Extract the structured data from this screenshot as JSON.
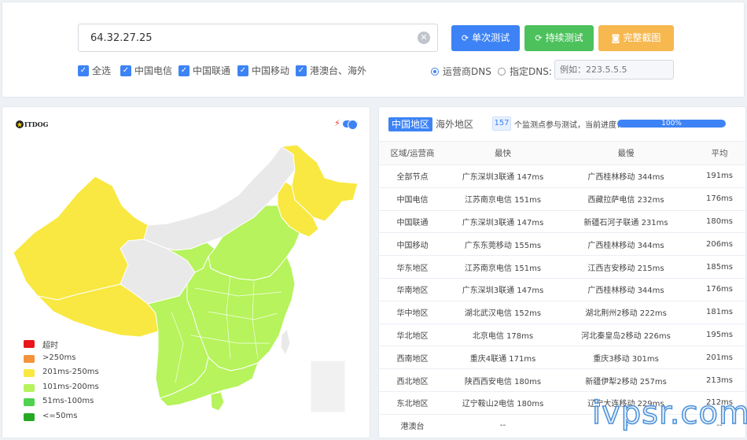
{
  "search": {
    "ip_value": "64.32.27.25",
    "clear_icon": "clear-circle-icon"
  },
  "buttons": {
    "single": {
      "label": "单次测试",
      "icon": "refresh-icon",
      "color": "#3d83f5"
    },
    "continuous": {
      "label": "持续测试",
      "icon": "refresh-icon",
      "color": "#4cc15c"
    },
    "screenshot": {
      "label": "完整截图",
      "icon": "camera-icon",
      "color": "#f7b850"
    }
  },
  "isp_filters": [
    {
      "label": "全选",
      "checked": true
    },
    {
      "label": "中国电信",
      "checked": true
    },
    {
      "label": "中国联通",
      "checked": true
    },
    {
      "label": "中国移动",
      "checked": true
    },
    {
      "label": "港澳台、海外",
      "checked": true
    }
  ],
  "dns": {
    "operator_label": "运营商DNS",
    "custom_label": "指定DNS:",
    "custom_placeholder": "例如：223.5.5.5",
    "selected": "operator"
  },
  "map": {
    "logo_text": "ITDOG",
    "legend": [
      {
        "label": "超时",
        "color": "#e8161b"
      },
      {
        "label": ">250ms",
        "color": "#f5933a"
      },
      {
        "label": "201ms-250ms",
        "color": "#f8e841"
      },
      {
        "label": "101ms-200ms",
        "color": "#b6f35c"
      },
      {
        "label": "51ms-100ms",
        "color": "#4fd24e"
      },
      {
        "label": "<=50ms",
        "color": "#27a822"
      }
    ]
  },
  "results": {
    "tabs": [
      "中国地区",
      "海外地区"
    ],
    "active_tab": "中国地区",
    "monitor_count": "157",
    "progress_text": "个监测点参与测试，当前进度：",
    "progress_percent": 100,
    "progress_label": "100%",
    "columns": [
      "区域/运营商",
      "最快",
      "最慢",
      "平均"
    ],
    "rows": [
      [
        "全部节点",
        "广东深圳3联通 147ms",
        "广西桂林移动 344ms",
        "191ms"
      ],
      [
        "中国电信",
        "江苏南京电信 151ms",
        "西藏拉萨电信 232ms",
        "176ms"
      ],
      [
        "中国联通",
        "广东深圳3联通 147ms",
        "新疆石河子联通 231ms",
        "180ms"
      ],
      [
        "中国移动",
        "广东东莞移动 155ms",
        "广西桂林移动 344ms",
        "206ms"
      ],
      [
        "华东地区",
        "江苏南京电信 151ms",
        "江西吉安移动 215ms",
        "185ms"
      ],
      [
        "华南地区",
        "广东深圳3联通 147ms",
        "广西桂林移动 344ms",
        "176ms"
      ],
      [
        "华中地区",
        "湖北武汉电信 152ms",
        "湖北荆州2移动 222ms",
        "181ms"
      ],
      [
        "华北地区",
        "北京电信 178ms",
        "河北秦皇岛2移动 226ms",
        "195ms"
      ],
      [
        "西南地区",
        "重庆4联通 171ms",
        "重庆3移动 301ms",
        "201ms"
      ],
      [
        "西北地区",
        "陕西西安电信 180ms",
        "新疆伊犁2移动 257ms",
        "213ms"
      ],
      [
        "东北地区",
        "辽宁鞍山2电信 180ms",
        "辽宁大连移动 229ms",
        "212ms"
      ],
      [
        "港澳台",
        "--",
        "--",
        "--"
      ]
    ]
  },
  "watermark": "ivpsr.com"
}
